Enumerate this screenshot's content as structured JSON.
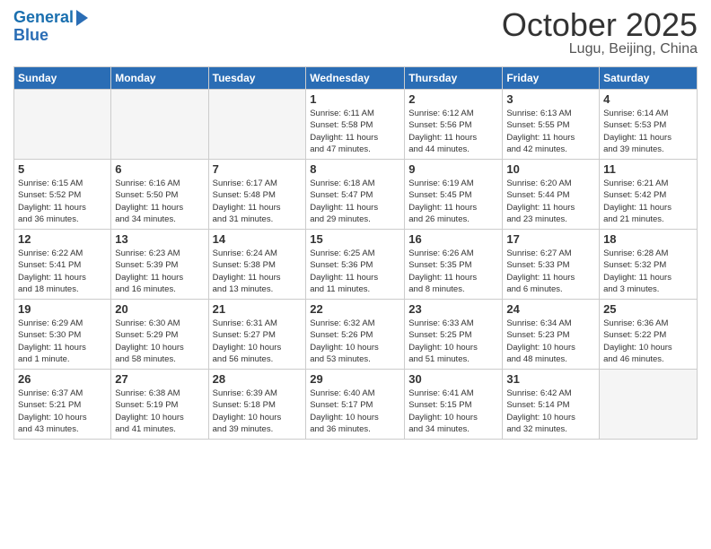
{
  "header": {
    "logo_line1": "General",
    "logo_line2": "Blue",
    "month": "October 2025",
    "location": "Lugu, Beijing, China"
  },
  "weekdays": [
    "Sunday",
    "Monday",
    "Tuesday",
    "Wednesday",
    "Thursday",
    "Friday",
    "Saturday"
  ],
  "weeks": [
    [
      {
        "day": "",
        "info": ""
      },
      {
        "day": "",
        "info": ""
      },
      {
        "day": "",
        "info": ""
      },
      {
        "day": "1",
        "info": "Sunrise: 6:11 AM\nSunset: 5:58 PM\nDaylight: 11 hours\nand 47 minutes."
      },
      {
        "day": "2",
        "info": "Sunrise: 6:12 AM\nSunset: 5:56 PM\nDaylight: 11 hours\nand 44 minutes."
      },
      {
        "day": "3",
        "info": "Sunrise: 6:13 AM\nSunset: 5:55 PM\nDaylight: 11 hours\nand 42 minutes."
      },
      {
        "day": "4",
        "info": "Sunrise: 6:14 AM\nSunset: 5:53 PM\nDaylight: 11 hours\nand 39 minutes."
      }
    ],
    [
      {
        "day": "5",
        "info": "Sunrise: 6:15 AM\nSunset: 5:52 PM\nDaylight: 11 hours\nand 36 minutes."
      },
      {
        "day": "6",
        "info": "Sunrise: 6:16 AM\nSunset: 5:50 PM\nDaylight: 11 hours\nand 34 minutes."
      },
      {
        "day": "7",
        "info": "Sunrise: 6:17 AM\nSunset: 5:48 PM\nDaylight: 11 hours\nand 31 minutes."
      },
      {
        "day": "8",
        "info": "Sunrise: 6:18 AM\nSunset: 5:47 PM\nDaylight: 11 hours\nand 29 minutes."
      },
      {
        "day": "9",
        "info": "Sunrise: 6:19 AM\nSunset: 5:45 PM\nDaylight: 11 hours\nand 26 minutes."
      },
      {
        "day": "10",
        "info": "Sunrise: 6:20 AM\nSunset: 5:44 PM\nDaylight: 11 hours\nand 23 minutes."
      },
      {
        "day": "11",
        "info": "Sunrise: 6:21 AM\nSunset: 5:42 PM\nDaylight: 11 hours\nand 21 minutes."
      }
    ],
    [
      {
        "day": "12",
        "info": "Sunrise: 6:22 AM\nSunset: 5:41 PM\nDaylight: 11 hours\nand 18 minutes."
      },
      {
        "day": "13",
        "info": "Sunrise: 6:23 AM\nSunset: 5:39 PM\nDaylight: 11 hours\nand 16 minutes."
      },
      {
        "day": "14",
        "info": "Sunrise: 6:24 AM\nSunset: 5:38 PM\nDaylight: 11 hours\nand 13 minutes."
      },
      {
        "day": "15",
        "info": "Sunrise: 6:25 AM\nSunset: 5:36 PM\nDaylight: 11 hours\nand 11 minutes."
      },
      {
        "day": "16",
        "info": "Sunrise: 6:26 AM\nSunset: 5:35 PM\nDaylight: 11 hours\nand 8 minutes."
      },
      {
        "day": "17",
        "info": "Sunrise: 6:27 AM\nSunset: 5:33 PM\nDaylight: 11 hours\nand 6 minutes."
      },
      {
        "day": "18",
        "info": "Sunrise: 6:28 AM\nSunset: 5:32 PM\nDaylight: 11 hours\nand 3 minutes."
      }
    ],
    [
      {
        "day": "19",
        "info": "Sunrise: 6:29 AM\nSunset: 5:30 PM\nDaylight: 11 hours\nand 1 minute."
      },
      {
        "day": "20",
        "info": "Sunrise: 6:30 AM\nSunset: 5:29 PM\nDaylight: 10 hours\nand 58 minutes."
      },
      {
        "day": "21",
        "info": "Sunrise: 6:31 AM\nSunset: 5:27 PM\nDaylight: 10 hours\nand 56 minutes."
      },
      {
        "day": "22",
        "info": "Sunrise: 6:32 AM\nSunset: 5:26 PM\nDaylight: 10 hours\nand 53 minutes."
      },
      {
        "day": "23",
        "info": "Sunrise: 6:33 AM\nSunset: 5:25 PM\nDaylight: 10 hours\nand 51 minutes."
      },
      {
        "day": "24",
        "info": "Sunrise: 6:34 AM\nSunset: 5:23 PM\nDaylight: 10 hours\nand 48 minutes."
      },
      {
        "day": "25",
        "info": "Sunrise: 6:36 AM\nSunset: 5:22 PM\nDaylight: 10 hours\nand 46 minutes."
      }
    ],
    [
      {
        "day": "26",
        "info": "Sunrise: 6:37 AM\nSunset: 5:21 PM\nDaylight: 10 hours\nand 43 minutes."
      },
      {
        "day": "27",
        "info": "Sunrise: 6:38 AM\nSunset: 5:19 PM\nDaylight: 10 hours\nand 41 minutes."
      },
      {
        "day": "28",
        "info": "Sunrise: 6:39 AM\nSunset: 5:18 PM\nDaylight: 10 hours\nand 39 minutes."
      },
      {
        "day": "29",
        "info": "Sunrise: 6:40 AM\nSunset: 5:17 PM\nDaylight: 10 hours\nand 36 minutes."
      },
      {
        "day": "30",
        "info": "Sunrise: 6:41 AM\nSunset: 5:15 PM\nDaylight: 10 hours\nand 34 minutes."
      },
      {
        "day": "31",
        "info": "Sunrise: 6:42 AM\nSunset: 5:14 PM\nDaylight: 10 hours\nand 32 minutes."
      },
      {
        "day": "",
        "info": ""
      }
    ]
  ]
}
